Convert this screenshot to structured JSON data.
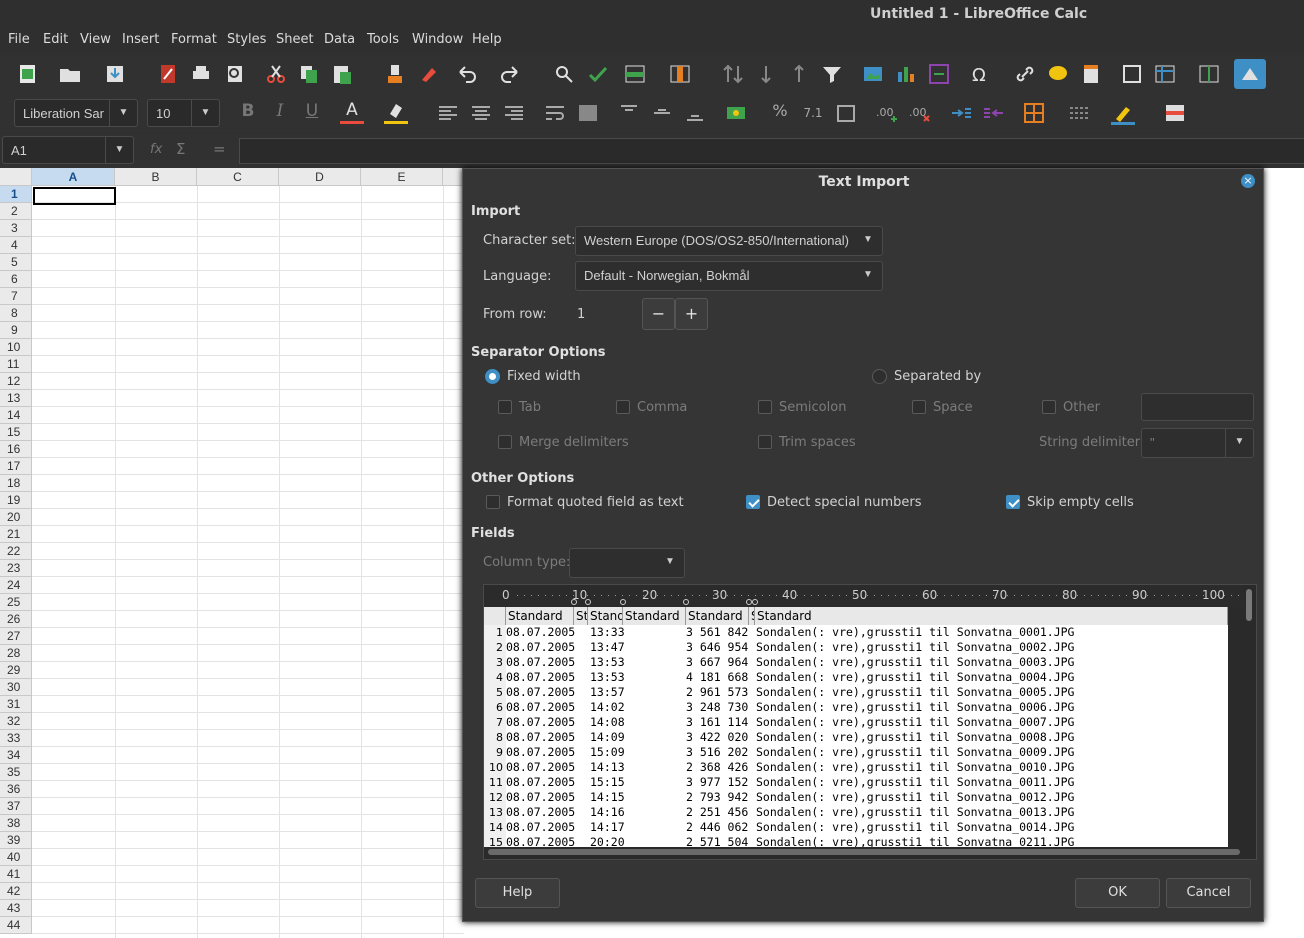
{
  "window": {
    "title": "Untitled 1 - LibreOffice Calc"
  },
  "menu": [
    "File",
    "Edit",
    "View",
    "Insert",
    "Format",
    "Styles",
    "Sheet",
    "Data",
    "Tools",
    "Window",
    "Help"
  ],
  "font_name": "Liberation Sar",
  "font_size": "10",
  "name_box": "A1",
  "columns": [
    "A",
    "B",
    "C",
    "D",
    "E"
  ],
  "rows": [
    "1",
    "2",
    "3",
    "4",
    "5",
    "6",
    "7",
    "8",
    "9",
    "10",
    "11",
    "12",
    "13",
    "14",
    "15",
    "16",
    "17",
    "18",
    "19",
    "20",
    "21",
    "22",
    "23",
    "24",
    "25",
    "26",
    "27",
    "28",
    "29",
    "30",
    "31",
    "32",
    "33",
    "34",
    "35",
    "36",
    "37",
    "38",
    "39",
    "40",
    "41",
    "42",
    "43",
    "44"
  ],
  "dialog": {
    "title": "Text Import",
    "import_label": "Import",
    "charset_label": "Character set:",
    "charset_value": "Western Europe (DOS/OS2-850/International)",
    "language_label": "Language:",
    "language_value": "Default - Norwegian, Bokmål",
    "fromrow_label": "From row:",
    "fromrow_value": "1",
    "sep_options_label": "Separator Options",
    "fixed_width": "Fixed width",
    "separated_by": "Separated by",
    "tab": "Tab",
    "comma": "Comma",
    "semicolon": "Semicolon",
    "space": "Space",
    "other": "Other",
    "merge_delims": "Merge delimiters",
    "trim_spaces": "Trim spaces",
    "string_delim_label": "String delimiter:",
    "string_delim_value": "\"",
    "other_options_label": "Other Options",
    "format_quoted": "Format quoted field as text",
    "detect_special": "Detect special numbers",
    "skip_empty": "Skip empty cells",
    "fields_label": "Fields",
    "column_type_label": "Column type:",
    "ruler": [
      "0",
      "10",
      "20",
      "30",
      "40",
      "50",
      "60",
      "70",
      "80",
      "90",
      "100"
    ],
    "col_headers": [
      "Standard",
      "St",
      "Stand",
      "Standard",
      "Standard",
      "S",
      "Standard"
    ],
    "help": "Help",
    "ok": "OK",
    "cancel": "Cancel"
  },
  "preview_rows": [
    [
      "1",
      "08.07.2005",
      "13:33",
      "3 561 842",
      "Sondalen(: vre),grussti1 til Sonvatna_0001.JPG"
    ],
    [
      "2",
      "08.07.2005",
      "13:47",
      "3 646 954",
      "Sondalen(: vre),grussti1 til Sonvatna_0002.JPG"
    ],
    [
      "3",
      "08.07.2005",
      "13:53",
      "3 667 964",
      "Sondalen(: vre),grussti1 til Sonvatna_0003.JPG"
    ],
    [
      "4",
      "08.07.2005",
      "13:53",
      "4 181 668",
      "Sondalen(: vre),grussti1 til Sonvatna_0004.JPG"
    ],
    [
      "5",
      "08.07.2005",
      "13:57",
      "2 961 573",
      "Sondalen(: vre),grussti1 til Sonvatna_0005.JPG"
    ],
    [
      "6",
      "08.07.2005",
      "14:02",
      "3 248 730",
      "Sondalen(: vre),grussti1 til Sonvatna_0006.JPG"
    ],
    [
      "7",
      "08.07.2005",
      "14:08",
      "3 161 114",
      "Sondalen(: vre),grussti1 til Sonvatna_0007.JPG"
    ],
    [
      "8",
      "08.07.2005",
      "14:09",
      "3 422 020",
      "Sondalen(: vre),grussti1 til Sonvatna_0008.JPG"
    ],
    [
      "9",
      "08.07.2005",
      "15:09",
      "3 516 202",
      "Sondalen(: vre),grussti1 til Sonvatna_0009.JPG"
    ],
    [
      "10",
      "08.07.2005",
      "14:13",
      "2 368 426",
      "Sondalen(: vre),grussti1 til Sonvatna_0010.JPG"
    ],
    [
      "11",
      "08.07.2005",
      "15:15",
      "3 977 152",
      "Sondalen(: vre),grussti1 til Sonvatna_0011.JPG"
    ],
    [
      "12",
      "08.07.2005",
      "14:15",
      "2 793 942",
      "Sondalen(: vre),grussti1 til Sonvatna_0012.JPG"
    ],
    [
      "13",
      "08.07.2005",
      "14:16",
      "2 251 456",
      "Sondalen(: vre),grussti1 til Sonvatna_0013.JPG"
    ],
    [
      "14",
      "08.07.2005",
      "14:17",
      "2 446 062",
      "Sondalen(: vre),grussti1 til Sonvatna_0014.JPG"
    ],
    [
      "15",
      "08.07.2005",
      "20:20",
      "2 571 504",
      "Sondalen(: vre),grussti1 til Sonvatna_0211.JPG"
    ]
  ]
}
